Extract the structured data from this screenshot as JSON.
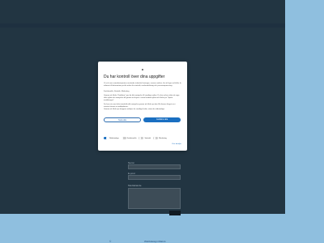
{
  "dialog": {
    "title": "Du har kontroll över dina uppgifter",
    "body1": "Vi och våra samarbetspartner använder tekniska lösningar, såsom cookies, för att lagra och/eller få åtkomst till information på din enhet för statistik, marknadsföring och personanpassning.",
    "body2": "Funktionella, Statistik, Marketing",
    "body3": "Genom att klicka \"Godkänn\" ger du ditt samtycke till samtliga syften. Du kan också välja att ange vilka syften du samtycker till genom att kryssa i rutan bredvid syftet och klicka på \"Spara inställningar\".",
    "body4": "Du kan när som helst återkalla ditt samtycke genom att klicka på den lilla ikonen längst ner i vänstra hörnet av webbplatsen.",
    "body5": "Genom att klicka på knappen avböjer du samtliga kakor, utom de nödvändiga.",
    "reject_label": "Neka alla",
    "accept_label": "Godkänn alla",
    "categories": [
      {
        "label": "Nödvändiga",
        "on": true
      },
      {
        "label": "Funktionella",
        "on": false
      },
      {
        "label": "Statistik",
        "on": false
      },
      {
        "label": "Marketing",
        "on": false
      }
    ],
    "more_link": "Visa detaljer"
  },
  "form": {
    "label1": "Namn",
    "label2": "E-post",
    "label3": "Meddelande"
  },
  "footer": {
    "number": "© ",
    "link": "Webbdesign Malmö"
  }
}
